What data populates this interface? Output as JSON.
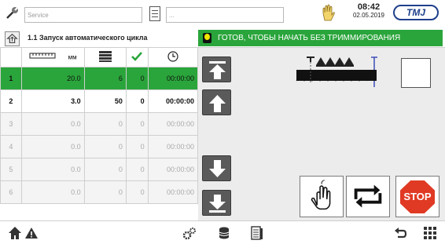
{
  "header": {
    "service_placeholder": "Service",
    "field2_placeholder": "...",
    "time": "08:42",
    "date": "02.05.2019",
    "logo": "TMJ"
  },
  "subheader": {
    "cycle_title": "1.1 Запуск автоматического цикла",
    "status_text": "ГОТОВ, ЧТОБЫ НАЧАТЬ БЕЗ ТРИММИРОВАНИЯ"
  },
  "table": {
    "columns": [
      "",
      "мм",
      "stack-icon",
      "check-icon",
      "clock-icon"
    ],
    "rows": [
      [
        "1",
        "20.0",
        "6",
        "0",
        "00:00:00"
      ],
      [
        "2",
        "3.0",
        "50",
        "0",
        "00:00:00"
      ],
      [
        "3",
        "0.0",
        "0",
        "0",
        "00:00:00"
      ],
      [
        "4",
        "0.0",
        "0",
        "0",
        "00:00:00"
      ],
      [
        "5",
        "0.0",
        "0",
        "0",
        "00:00:00"
      ],
      [
        "6",
        "0.0",
        "0",
        "0",
        "00:00:00"
      ]
    ]
  },
  "buttons": {
    "stop": "STOP"
  },
  "colors": {
    "status_green": "#2aa53b",
    "stop_red": "#e03a24",
    "logo_blue": "#1e3f8a"
  }
}
